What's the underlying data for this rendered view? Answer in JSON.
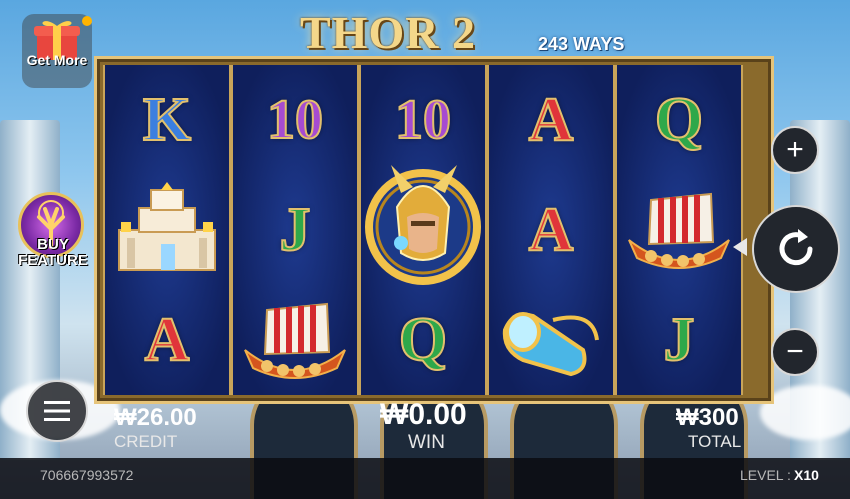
{
  "game": {
    "title": "THOR 2",
    "ways": "243 WAYS"
  },
  "buttons": {
    "get_more": "Get More",
    "buy_feature_line1": "BUY",
    "buy_feature_line2": "FEATURE"
  },
  "reels": [
    [
      "K",
      "palace",
      "A"
    ],
    [
      "10",
      "J",
      "ship"
    ],
    [
      "10",
      "thor",
      "Q"
    ],
    [
      "A",
      "A",
      "horn"
    ],
    [
      "Q",
      "ship",
      "J"
    ]
  ],
  "symbol_colors": {
    "K": "blue",
    "10": "purple",
    "J": "green",
    "Q": "green",
    "A": "red"
  },
  "footer": {
    "credit_value": "₩26.00",
    "credit_label": "CREDIT",
    "win_value": "₩0.00",
    "win_label": "WIN",
    "total_value": "₩300",
    "total_label": "TOTAL",
    "player_id": "706667993572",
    "level_label": "LEVEL :",
    "level_value": "X10"
  }
}
